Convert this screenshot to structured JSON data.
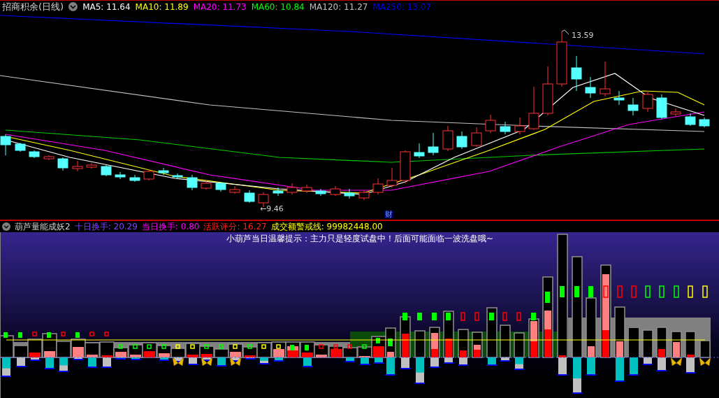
{
  "main_chart": {
    "title": "招商积余(日线)",
    "indicators": [
      {
        "text": "MA5: 11.64",
        "color": "#ffffff"
      },
      {
        "text": "MA10: 11.89",
        "color": "#ffff00"
      },
      {
        "text": "MA20: 11.73",
        "color": "#ff00ff"
      },
      {
        "text": "MA60: 10.84",
        "color": "#00ff00"
      },
      {
        "text": "MA120: 11.27",
        "color": "#c0c0c0"
      },
      {
        "text": "MA250: 13.07",
        "color": "#0000ff"
      }
    ],
    "high_label": "13.59",
    "low_label": "←9.46",
    "event_marker": "财"
  },
  "indicator_pane": {
    "title": "葫芦量能成妖2",
    "readings": [
      {
        "text": "十日换手: 20.29",
        "color": "#8040ff"
      },
      {
        "text": "当日换手: 0.80",
        "color": "#ff00ff"
      },
      {
        "text": "活跃评分: 16.27",
        "color": "#ff2020"
      },
      {
        "text": "成交额警戒线: 99982448.00",
        "color": "#ffff00"
      }
    ],
    "tip": "小葫芦当日温馨提示：主力只是轻度试盘中！后面可能面临一波洗盘哦~"
  }
}
